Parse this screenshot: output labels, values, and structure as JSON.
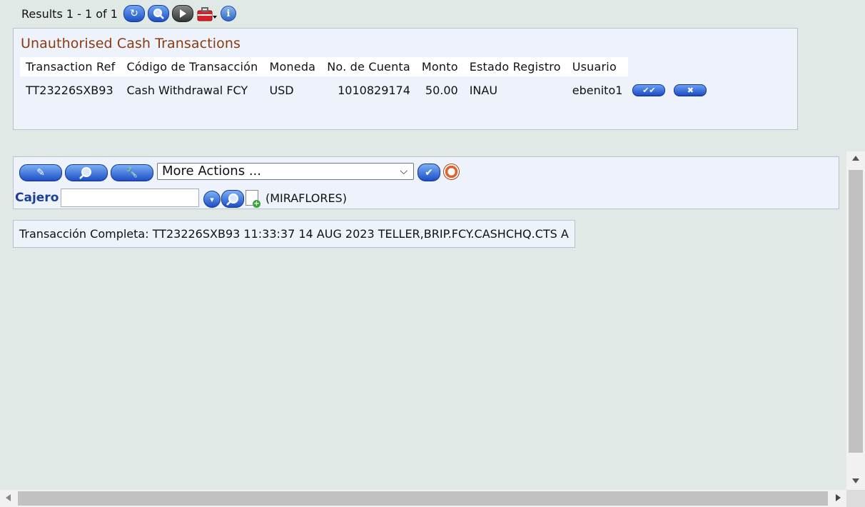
{
  "toolbar": {
    "results_text": "Results 1 - 1 of 1",
    "icons": [
      "refresh-icon",
      "search-icon",
      "next-icon",
      "toolbox-icon",
      "info-icon"
    ]
  },
  "unauth_panel": {
    "title": "Unauthorised Cash Transactions",
    "columns": [
      "Transaction Ref",
      "Código de Transacción",
      "Moneda",
      "No. de Cuenta",
      "Monto",
      "Estado Registro",
      "Usuario"
    ],
    "rows": [
      {
        "transaction_ref": "TT23226SXB93",
        "codigo": "Cash Withdrawal FCY",
        "moneda": "USD",
        "cuenta": "1010829174",
        "monto": "50.00",
        "estado": "INAU",
        "usuario": "ebenito1"
      }
    ],
    "row_actions": [
      "authorise-button",
      "delete-button"
    ]
  },
  "actions_panel": {
    "buttons": [
      "edit-icon",
      "search-icon",
      "tools-icon"
    ],
    "more_actions_label": "More Actions ...",
    "cajero_label": "Cajero",
    "cajero_value": "",
    "branch_text": "(MIRAFLORES)"
  },
  "message": {
    "text": "Transacción Completa: TT23226SXB93 11:33:37 14 AUG 2023 TELLER,BRIP.FCY.CASHCHQ.CTS A"
  },
  "colors": {
    "background": "#e1e9e7",
    "panel": "#eef2fb",
    "title": "#8b3a10",
    "label_blue": "#1c3f9a",
    "button_blue": "#1d4ec6"
  }
}
